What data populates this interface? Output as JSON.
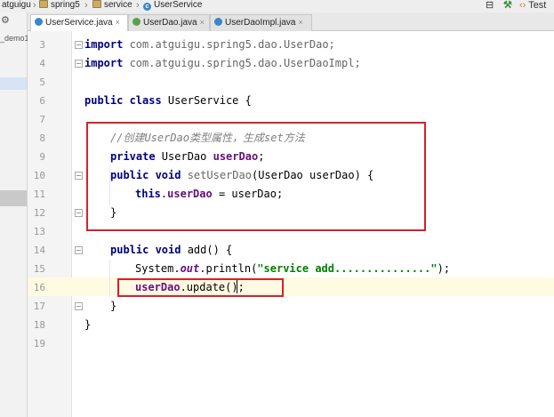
{
  "breadcrumb": [
    "atguigu",
    "spring5",
    "service",
    "UserService"
  ],
  "toolbar_right": "Test",
  "left_panel": {
    "project_label": "_demo1"
  },
  "tabs": [
    {
      "label": "UserService.java",
      "active": true,
      "icon": "class-icon"
    },
    {
      "label": "UserDao.java",
      "active": false,
      "icon": "interface-icon"
    },
    {
      "label": "UserDaoImpl.java",
      "active": false,
      "icon": "class-icon"
    }
  ],
  "editor": {
    "line_numbers": [
      "3",
      "4",
      "5",
      "6",
      "7",
      "8",
      "9",
      "10",
      "11",
      "12",
      "13",
      "14",
      "15",
      "16",
      "17",
      "18",
      "19"
    ],
    "current_line": "16",
    "lines": {
      "l3": {
        "kw": "import",
        "rest": " com.atguigu.spring5.dao.UserDao;"
      },
      "l4": {
        "kw": "import",
        "rest": " com.atguigu.spring5.dao.UserDaoImpl;"
      },
      "l6": {
        "kw": "public class",
        "rest": " UserService {"
      },
      "l8": {
        "comment": "//创建UserDao类型属性，生成set方法"
      },
      "l9": {
        "kw": "private",
        "type": " UserDao ",
        "field": "userDao",
        "end": ";"
      },
      "l10": {
        "kw": "public void",
        "method": " setUserDao",
        "rest": "(UserDao userDao) {"
      },
      "l11": {
        "kw": "this",
        "dot": ".",
        "field": "userDao",
        "rest": " = userDao;"
      },
      "l12": {
        "rest": "}"
      },
      "l14": {
        "kw": "public void",
        "rest": " add() {"
      },
      "l15": {
        "pre": "System.",
        "static": "out",
        "mid": ".println(",
        "str": "\"service add...............\"",
        "end": ");"
      },
      "l16": {
        "field": "userDao",
        "rest": ".update();"
      },
      "l17": {
        "rest": "}"
      },
      "l18": {
        "rest": "}"
      }
    }
  },
  "colors": {
    "annotation_red": "#d8202a",
    "keyword": "#000080",
    "field": "#660e7a",
    "string": "#008000",
    "comment": "#808080",
    "current_line_bg": "#fffbe2"
  }
}
